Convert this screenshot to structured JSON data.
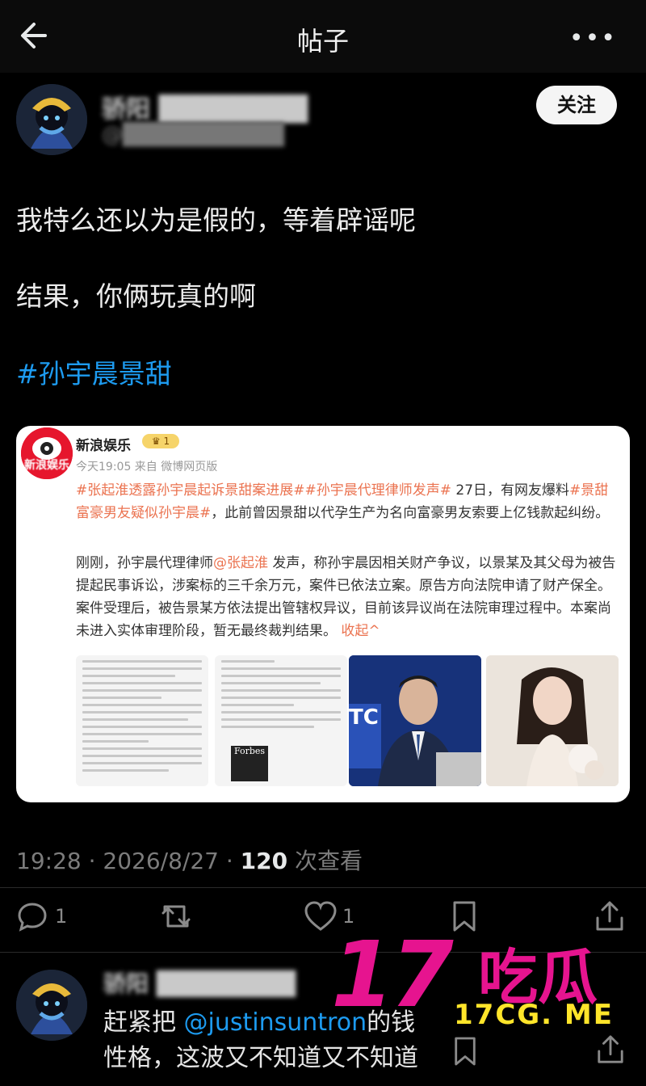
{
  "header": {
    "title": "帖子",
    "more_label": "•••"
  },
  "post": {
    "author_name_blurred": "骄阳 ████████",
    "author_handle_blurred": "@██████████",
    "follow_label": "关注",
    "lines": [
      "我特么还以为是假的，等着辟谣呢",
      "结果，你俩玩真的啊"
    ],
    "hashtag": "#孙宇晨景甜",
    "card": {
      "source_name": "新浪娱乐",
      "badge": "1",
      "meta": "今天19:05  来自 微博网页版",
      "logo_text": "新浪娱乐",
      "para1_tags": "#张起淮透露孙宇晨起诉景甜案进展##孙宇晨代理律师发声#",
      "para1_text": " 27日，有网友爆料",
      "para1_tag2": "#景甜富豪男友疑似孙宇晨#",
      "para1_tail": "，此前曾因景甜以代孕生产为名向富豪男友索要上亿钱款起纠纷。",
      "para2_head": "刚刚，孙宇晨代理律师",
      "para2_mention": "@张起淮",
      "para2_text": " 发声，称孙宇晨因相关财产争议，以景某及其父母为被告提起民事诉讼，涉案标的三千余万元，案件已依法立案。原告方向法院申请了财产保全。案件受理后，被告景某方依法提出管辖权异议，目前该异议尚在法院审理过程中。本案尚未进入实体审理阶段，暂无最终裁判结果。",
      "collapse": "收起^",
      "thumb_labels": [
        "Forbes",
        "TC"
      ]
    },
    "stats": {
      "time": "19:28 · 2026/8/27 · ",
      "views": "120",
      "views_label": " 次查看"
    },
    "actions": {
      "reply_count": "1",
      "like_count": "1"
    }
  },
  "reply": {
    "author_blurred": "骄阳 ████████",
    "line1_prefix": "赶紧把 ",
    "line1_mention": "@justinsuntron",
    "line1_suffix": "的钱",
    "line2": "性格，这波又不知道又不知道"
  },
  "watermark": {
    "big": "17",
    "cn": "吃瓜",
    "url": "17CG. ME"
  },
  "colors": {
    "link_blue": "#1d9bf0",
    "weibo_orange": "#eb7350",
    "watermark_pink": "#e6148f",
    "watermark_yellow": "#ffe52a"
  }
}
